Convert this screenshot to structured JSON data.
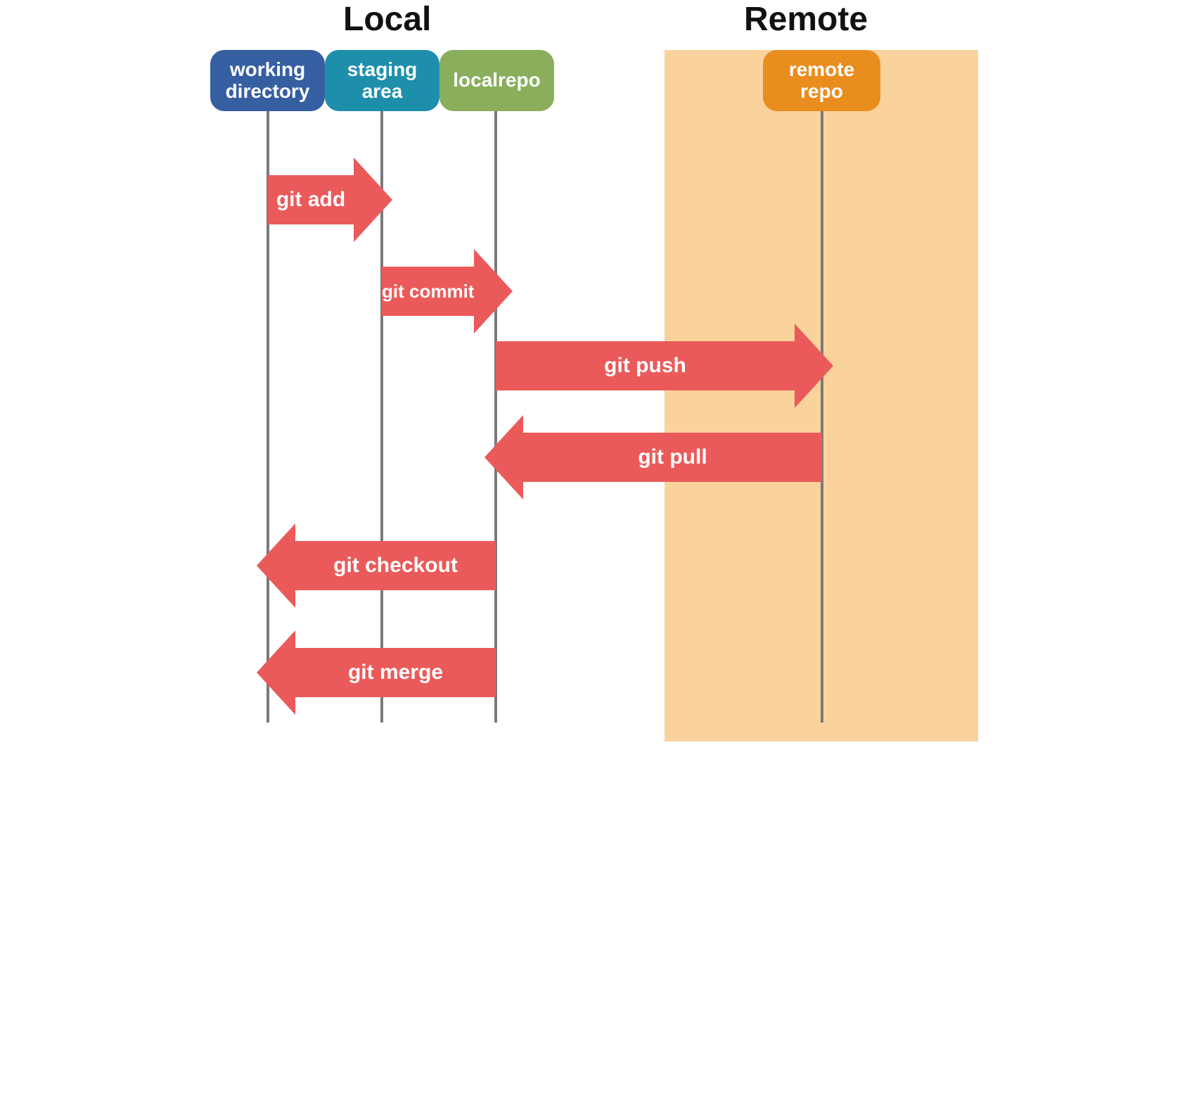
{
  "titles": {
    "local": "Local",
    "remote": "Remote"
  },
  "lanes": {
    "working": {
      "label": "working directory",
      "color": "#365fa1"
    },
    "staging": {
      "label": "staging area",
      "color": "#1e8fab"
    },
    "localrepo": {
      "label": "localrepo",
      "color": "#8aae5c"
    },
    "remoterepo": {
      "label": "remote repo",
      "color": "#ea8d1f"
    }
  },
  "arrowColor": "#eb5a5a",
  "remoteBg": "#f9d29c",
  "arrows": {
    "add": {
      "label": "git add",
      "from": "working",
      "to": "staging",
      "dir": "right"
    },
    "commit": {
      "label": "git commit",
      "from": "staging",
      "to": "localrepo",
      "dir": "right"
    },
    "push": {
      "label": "git push",
      "from": "localrepo",
      "to": "remoterepo",
      "dir": "right"
    },
    "pull": {
      "label": "git pull",
      "from": "remoterepo",
      "to": "localrepo",
      "dir": "left"
    },
    "checkout": {
      "label": "git checkout",
      "from": "localrepo",
      "to": "working",
      "dir": "left"
    },
    "merge": {
      "label": "git merge",
      "from": "localrepo",
      "to": "working",
      "dir": "left"
    }
  }
}
